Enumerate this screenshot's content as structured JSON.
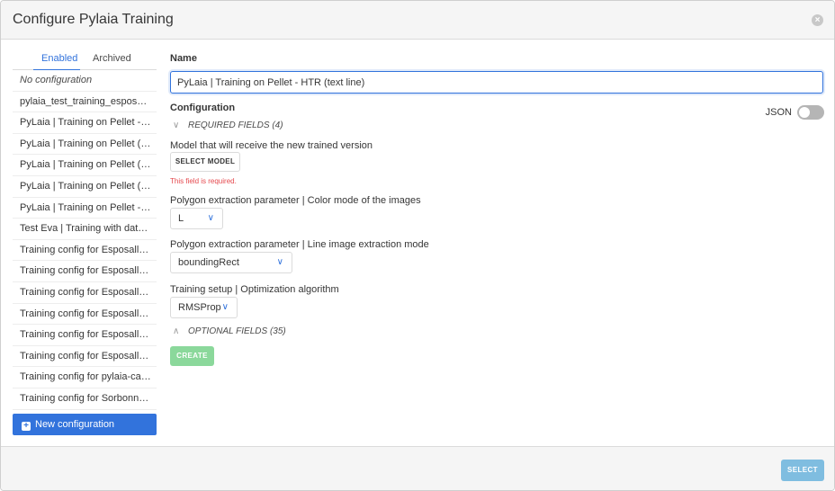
{
  "modal": {
    "title": "Configure Pylaia Training",
    "close_glyph": "×"
  },
  "sidebar": {
    "tabs": [
      {
        "label": "Enabled",
        "active": true
      },
      {
        "label": "Archived",
        "active": false
      }
    ],
    "items": [
      "No configuration",
      "pylaia_test_training_esposalle…",
      "PyLaia | Training on Pellet - …",
      "PyLaia | Training on Pellet (d…",
      "PyLaia | Training on Pellet (d…",
      "PyLaia | Training on Pellet (d…",
      "PyLaia | Training on Pellet - …",
      "Test Eva | Training with datas…",
      "Training config for Esposalle…",
      "Training config for Esposalles…",
      "Training config for Esposalles…",
      "Training config for Esposalles…",
      "Training config for Esposalles…",
      "Training config for Esposalles…",
      "Training config for pylaia-cas…",
      "Training config for Sorbonne I…"
    ],
    "new_button": {
      "label": "New configuration",
      "icon": "plus-square-icon"
    }
  },
  "form": {
    "name_label": "Name",
    "name_value": "PyLaia | Training on Pellet - HTR (text line)",
    "config_label": "Configuration",
    "json_label": "JSON",
    "json_enabled": false,
    "required_toggle": "REQUIRED FIELDS (4)",
    "optional_toggle": "OPTIONAL FIELDS (35)",
    "fields": {
      "model_label": "Model that will receive the new trained version",
      "select_model_button": "SELECT MODEL",
      "model_error": "This field is required.",
      "color_mode_label": "Polygon extraction parameter | Color mode of the images",
      "color_mode_value": "L",
      "line_mode_label": "Polygon extraction parameter | Line image extraction mode",
      "line_mode_value": "boundingRect",
      "optimizer_label": "Training setup | Optimization algorithm",
      "optimizer_value": "RMSProp"
    },
    "create_button": "CREATE"
  },
  "footer": {
    "select_button": "SELECT"
  },
  "colors": {
    "accent": "#3273dc",
    "create_btn": "#8bd89b",
    "select_btn": "#7fbde0",
    "error": "#e5484d"
  }
}
